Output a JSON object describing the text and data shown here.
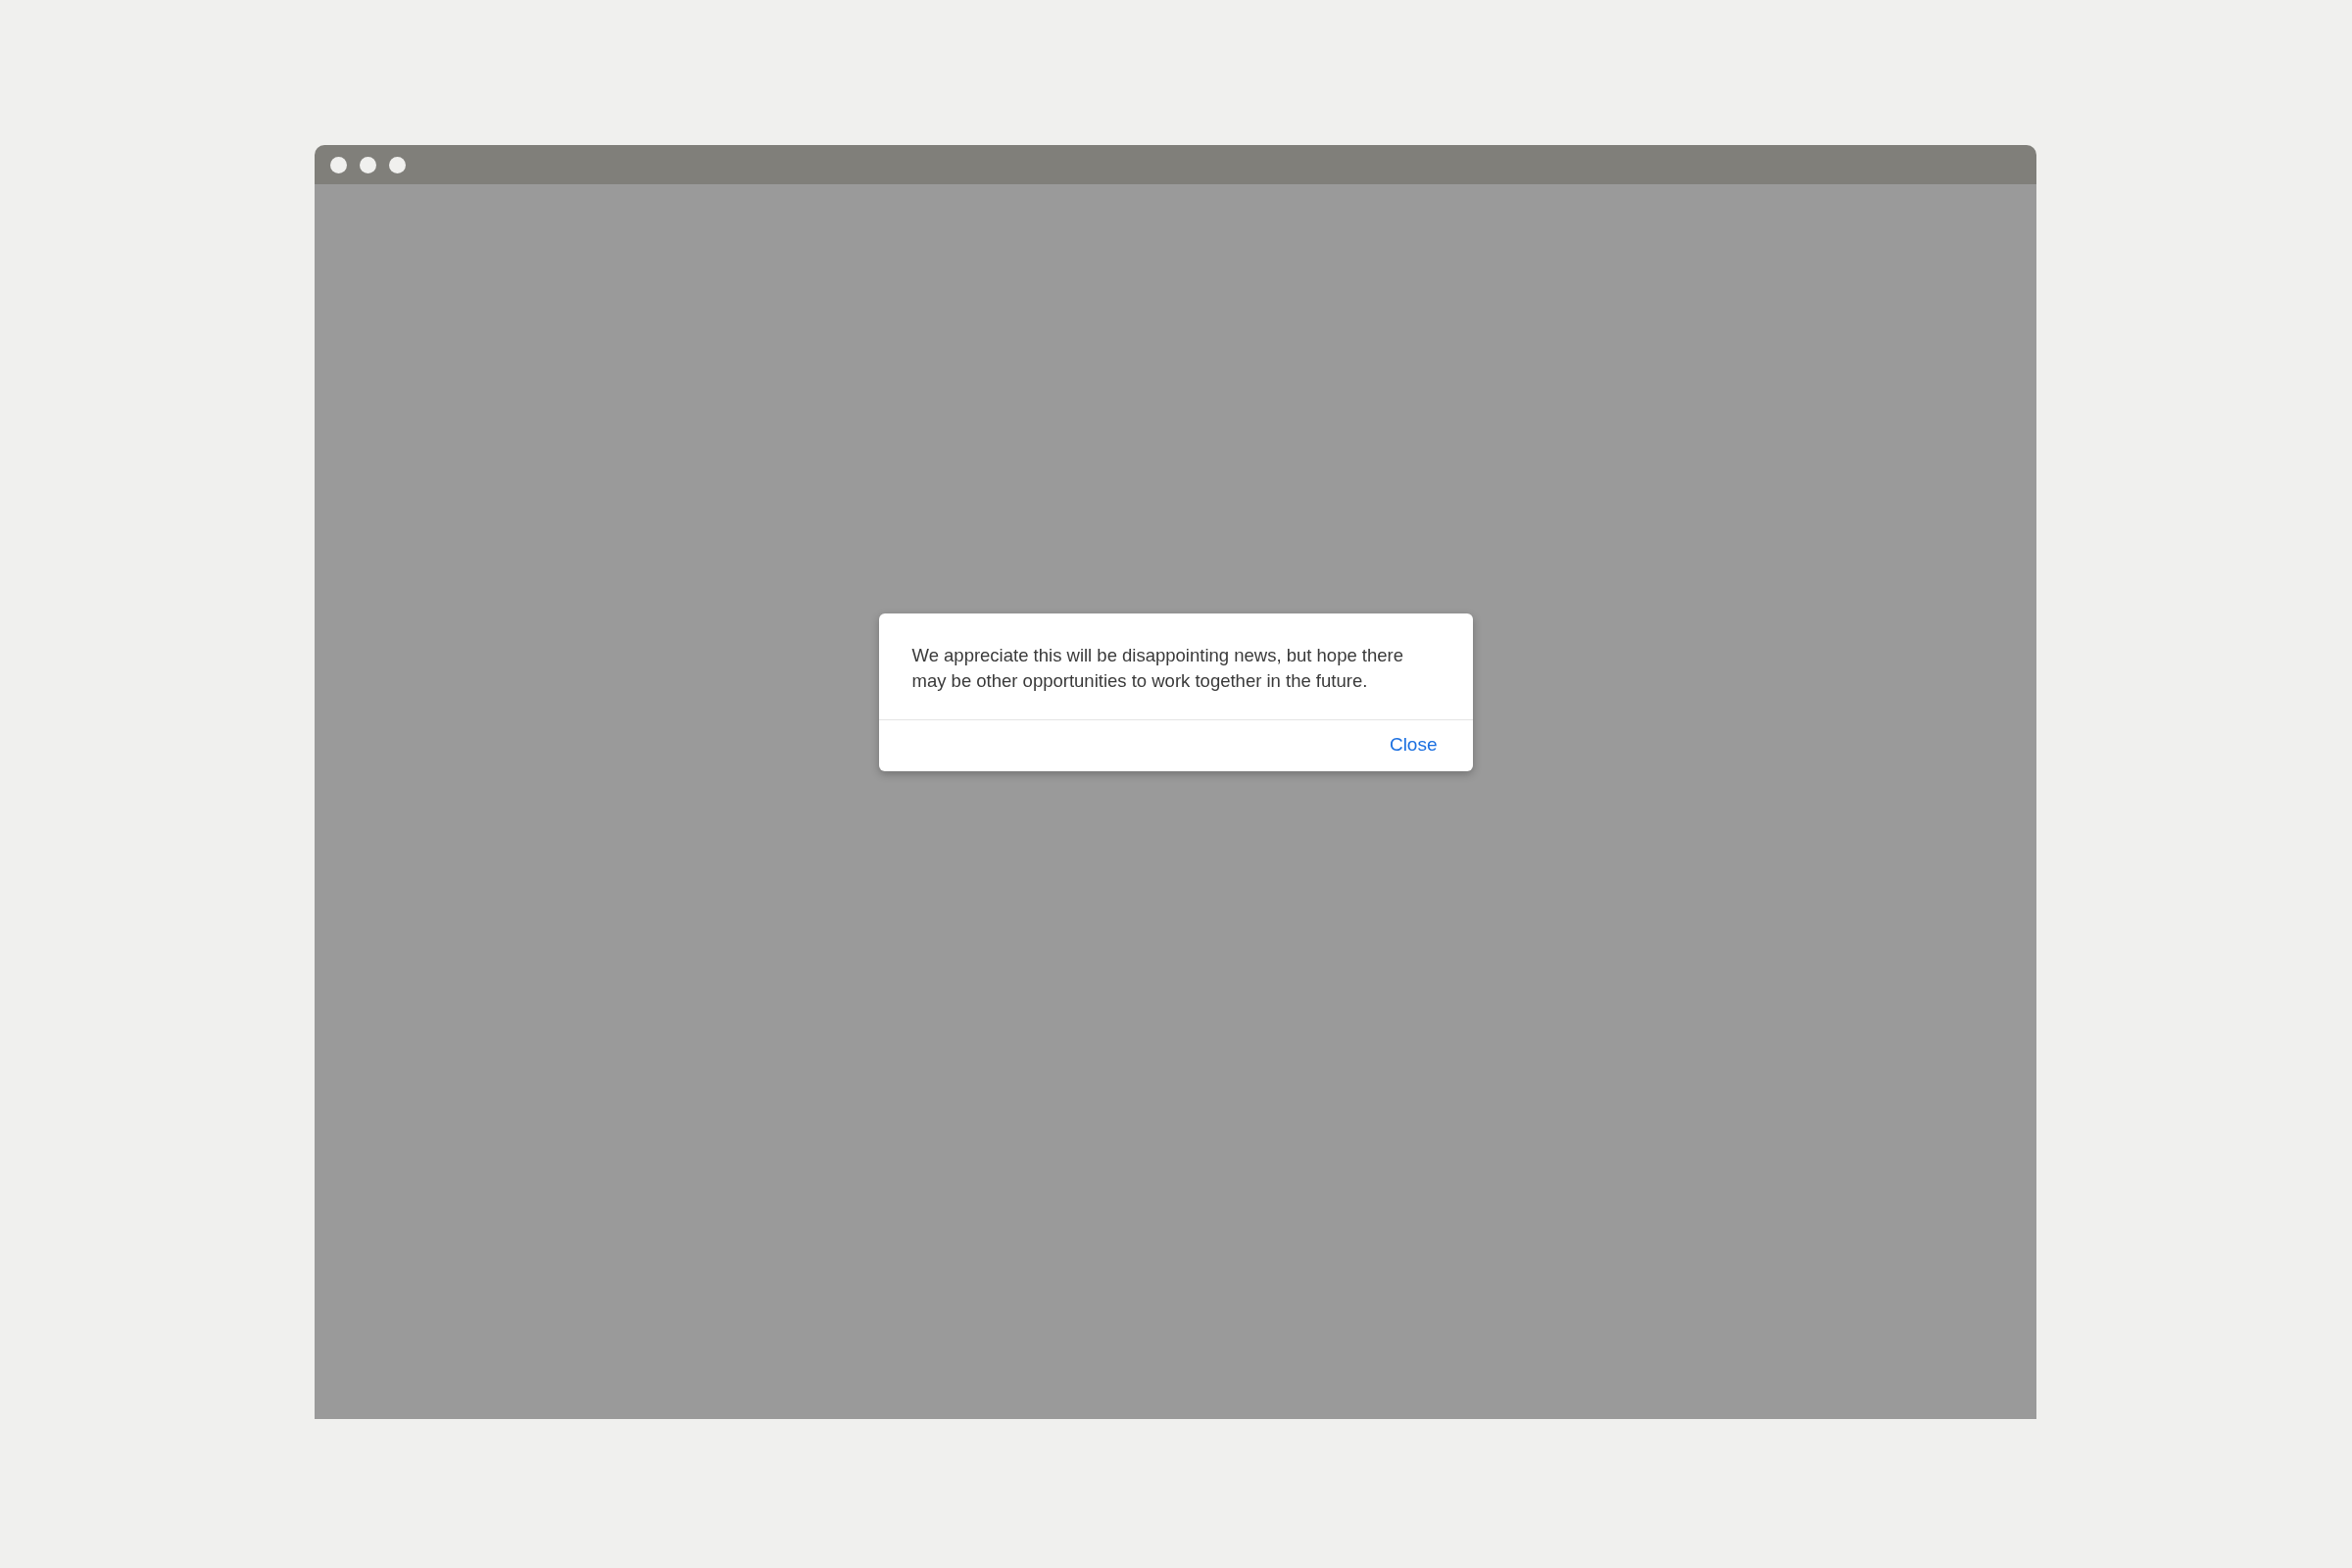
{
  "dialog": {
    "message": "We appreciate this will be disappointing news, but hope there may be other opportunities to work together in the future.",
    "button": "Close"
  }
}
